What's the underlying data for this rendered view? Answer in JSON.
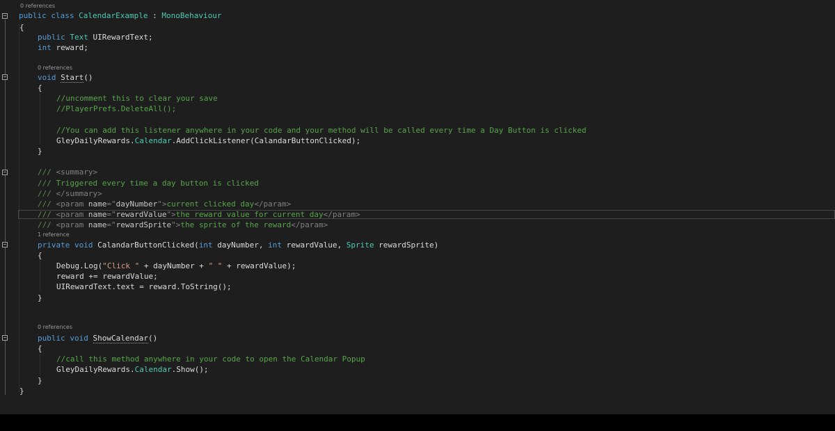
{
  "editor": {
    "code_lens": {
      "class": "0 references",
      "start": "0 references",
      "clicked": "1 reference",
      "show": "0 references"
    },
    "lines": {
      "l1": {
        "kw1": "public",
        "kw2": "class",
        "name": "CalendarExample",
        "colon": " : ",
        "base": "MonoBehaviour"
      },
      "l2": {
        "brace": "{"
      },
      "l3": {
        "kw": "public",
        "type": "Text",
        "rest": " UIRewardText;"
      },
      "l4": {
        "kw": "int",
        "rest": " reward;"
      },
      "l5": {
        "kw": "void",
        "name": "Start",
        "rest": "()"
      },
      "l6": {
        "brace": "{"
      },
      "l7": {
        "comment": "//uncomment this to clear your save"
      },
      "l8": {
        "comment": "//PlayerPrefs.DeleteAll();"
      },
      "l9": {
        "comment": "//You can add this listener anywhere in your code and your method will be called every time a Day Button is clicked"
      },
      "l10": {
        "a": "GleyDailyRewards.",
        "type": "Calendar",
        "b": ".AddClickListener(CalandarButtonClicked);"
      },
      "l11": {
        "brace": "}"
      },
      "l12": {
        "slashes": "///",
        "tag": " <summary>"
      },
      "l13": {
        "slashes": "///",
        "text": " Triggered every time a day button is clicked"
      },
      "l14": {
        "slashes": "///",
        "tag": " </summary>"
      },
      "l15": {
        "slashes": "///",
        "open": " <param ",
        "attr": "name",
        "eq": "=\"",
        "val": "dayNumber",
        "close": "\">",
        "text": "current clicked day",
        "end": "</param>"
      },
      "l16": {
        "slashes": "///",
        "open": " <param ",
        "attr": "name",
        "eq": "=\"",
        "val": "rewardValue",
        "close": "\">",
        "text": "the reward value for current day",
        "end": "</param>"
      },
      "l17": {
        "slashes": "///",
        "open": " <param ",
        "attr": "name",
        "eq": "=\"",
        "val": "rewardSprite",
        "close": "\">",
        "text": "the sprite of the reward",
        "end": "</param>"
      },
      "l18": {
        "kw1": "private",
        "kw2": "void",
        "name": " CalandarButtonClicked(",
        "kw3": "int",
        "p1": " dayNumber, ",
        "kw4": "int",
        "p2": " rewardValue, ",
        "type": "Sprite",
        "p3": " rewardSprite)"
      },
      "l19": {
        "brace": "{"
      },
      "l20": {
        "a": "Debug.Log(",
        "s1": "\"Click \"",
        "b": " + dayNumber + ",
        "s2": "\" \"",
        "c": " + rewardValue);"
      },
      "l21": {
        "text": "reward += rewardValue;"
      },
      "l22": {
        "text": "UIRewardText.text = reward.ToString();"
      },
      "l23": {
        "brace": "}"
      },
      "l24": {
        "kw1": "public",
        "kw2": "void",
        "name": "ShowCalendar",
        "rest": "()"
      },
      "l25": {
        "brace": "{"
      },
      "l26": {
        "comment": "//call this method anywhere in your code to open the Calendar Popup"
      },
      "l27": {
        "a": "GleyDailyRewards.",
        "type": "Calendar",
        "b": ".Show();"
      },
      "l28": {
        "brace": "}"
      },
      "l29": {
        "brace": "}"
      }
    }
  },
  "colors": {
    "background": "#1e1e1e",
    "keyword": "#569cd6",
    "type": "#4ec9b0",
    "comment": "#57a64a",
    "string": "#d69d85",
    "identifier": "#dcdcdc"
  }
}
